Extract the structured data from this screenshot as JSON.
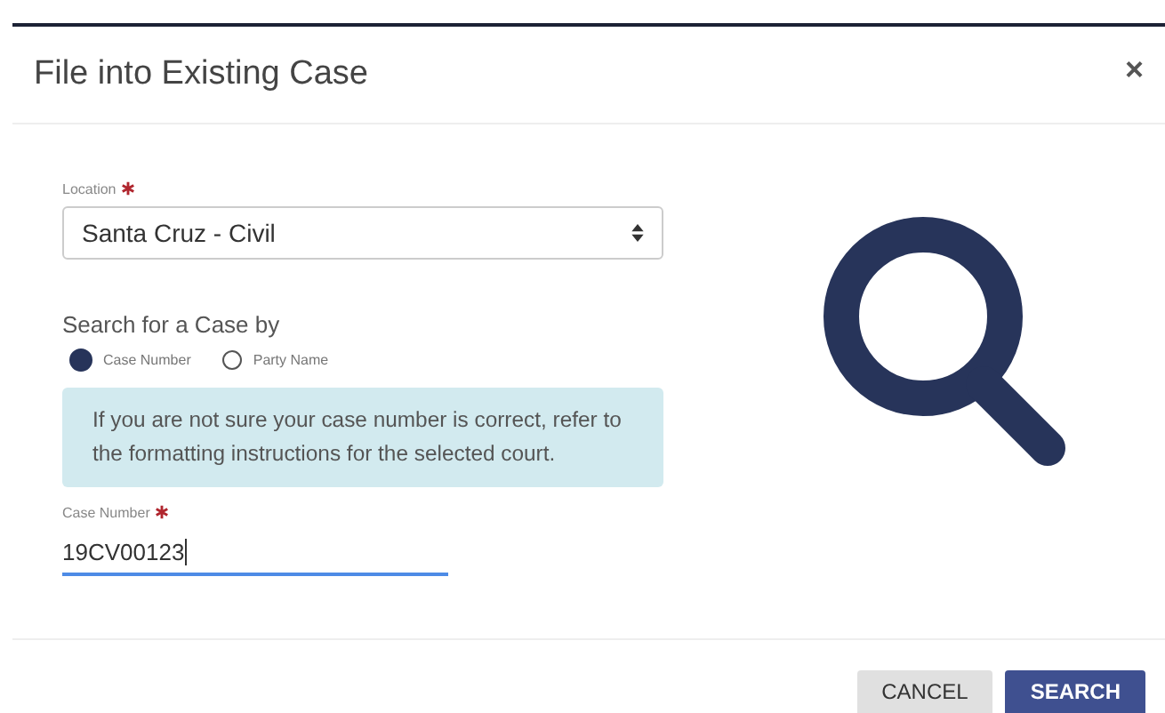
{
  "dialog": {
    "title": "File into Existing Case",
    "close": "×"
  },
  "location": {
    "label": "Location",
    "required": true,
    "value": "Santa Cruz - Civil"
  },
  "search_by": {
    "label": "Search for a Case by",
    "options": [
      {
        "label": "Case Number",
        "selected": true
      },
      {
        "label": "Party Name",
        "selected": false
      }
    ]
  },
  "info": "If you are not sure your case number is correct, refer to the formatting instructions for the selected court.",
  "case_number": {
    "label": "Case Number",
    "required": true,
    "value": "19CV00123",
    "focused": true
  },
  "buttons": [
    {
      "label": "CANCEL",
      "kind": "secondary"
    },
    {
      "label": "SEARCH",
      "kind": "primary"
    }
  ]
}
